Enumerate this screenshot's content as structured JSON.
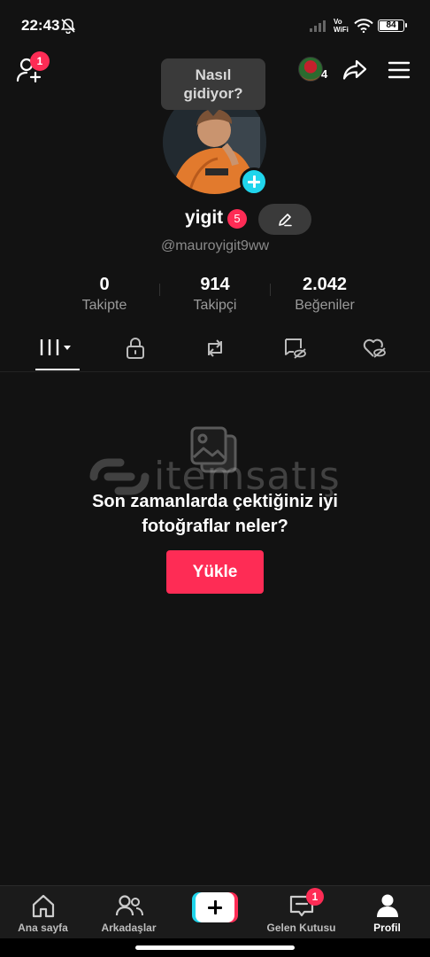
{
  "status_bar": {
    "time": "22:43",
    "network_label": "Vo\nWiFi",
    "battery": "84",
    "battery_level": 0.84
  },
  "header": {
    "add_friend_badge": "1",
    "coin_count": "4"
  },
  "profile": {
    "tooltip": "Nasıl\ngidiyor?",
    "display_name": "yigit",
    "name_badge": "5",
    "username": "@mauroyigit9ww"
  },
  "stats": [
    {
      "value": "0",
      "label": "Takipte"
    },
    {
      "value": "914",
      "label": "Takipçi"
    },
    {
      "value": "2.042",
      "label": "Beğeniler"
    }
  ],
  "tabs": [
    {
      "icon": "grid-icon",
      "active": true
    },
    {
      "icon": "lock-icon",
      "active": false
    },
    {
      "icon": "repost-icon",
      "active": false
    },
    {
      "icon": "tagged-hidden-icon",
      "active": false
    },
    {
      "icon": "liked-hidden-icon",
      "active": false
    }
  ],
  "empty_state": {
    "watermark": "itemsatış",
    "text": "Son zamanlarda çektiğiniz iyi\nfotoğraflar neler?",
    "button": "Yükle"
  },
  "bottom_nav": {
    "home": "Ana sayfa",
    "friends": "Arkadaşlar",
    "inbox": "Gelen Kutusu",
    "inbox_badge": "1",
    "profile": "Profil"
  },
  "colors": {
    "accent": "#fe2c55",
    "cyan": "#20d5ec",
    "background": "#121212"
  }
}
